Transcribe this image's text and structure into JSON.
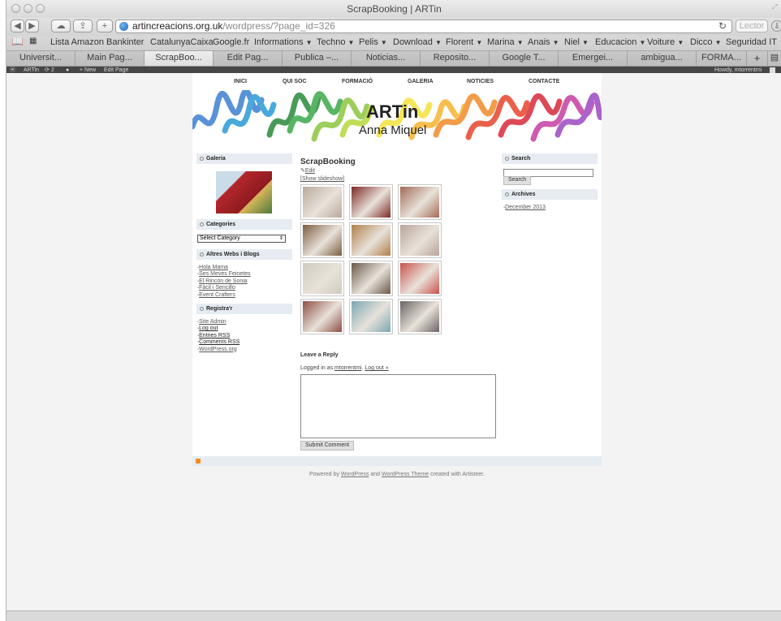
{
  "browser": {
    "window_title": "ScrapBooking | ARTin",
    "url_host": "artincreacions.org.uk",
    "url_path": "/wordpress/?page_id=326",
    "reader_label": "Lector"
  },
  "bookmarks": [
    {
      "label": "Lista Amazon",
      "menu": false
    },
    {
      "label": "Bankinter",
      "menu": false
    },
    {
      "label": "CatalunyaCaixa",
      "menu": false
    },
    {
      "label": "Google.fr",
      "menu": false
    },
    {
      "label": "Informations",
      "menu": true
    },
    {
      "label": "Techno",
      "menu": true
    },
    {
      "label": "Pelis",
      "menu": true
    },
    {
      "label": "Download",
      "menu": true
    },
    {
      "label": "Florent",
      "menu": true
    },
    {
      "label": "Marina",
      "menu": true
    },
    {
      "label": "Anais",
      "menu": true
    },
    {
      "label": "Niel",
      "menu": true
    },
    {
      "label": "Educacion",
      "menu": true
    },
    {
      "label": "Voiture",
      "menu": true
    },
    {
      "label": "Dicco",
      "menu": true
    },
    {
      "label": "Seguridad IT",
      "menu": true
    }
  ],
  "tabs": [
    "Universit...",
    "Main Pag...",
    "ScrapBoo...",
    "Edit Pag...",
    "Publica –...",
    "Noticias...",
    "Reposito...",
    "Google T...",
    "Emergei...",
    "ambigua...",
    "FORMA..."
  ],
  "active_tab": 2,
  "adminbar": {
    "site": "ARTin",
    "updates": "2",
    "new": "+ New",
    "edit": "Edit Page",
    "howdy": "Howdy, mtorrentmi"
  },
  "site": {
    "nav": [
      "INICI",
      "QUI SOC",
      "FORMACIÓ",
      "GALERIA",
      "NOTICIES",
      "CONTACTE"
    ],
    "brand": "ARTin",
    "tagline": "Anna Miquel"
  },
  "sidebar_left": {
    "galeria_title": "Galeria",
    "categories_title": "Categories",
    "category_select": "Select Category",
    "blogs_title": "Altres Webs i Blogs",
    "blogs": [
      "Hola Mama",
      "Ses Meves Feinetes",
      "El Rincón de Sonia",
      "Fàcil i Sencillo",
      "Event Crafters"
    ],
    "register_title": "Registra'r",
    "register_links": [
      "Site Admin",
      "Log out",
      "Entries RSS",
      "Comments RSS",
      "WordPress.org"
    ]
  },
  "main": {
    "title": "ScrapBooking",
    "edit_link": "Edit",
    "slideshow_link": "[Show slideshow]",
    "gallery_colors": [
      [
        "#b9a99a",
        "#7e2a25",
        "#a46a57"
      ],
      [
        "#7c5c40",
        "#b07f4a",
        "#b8a59a"
      ],
      [
        "#cfcac0",
        "#6a5848",
        "#c9524b"
      ],
      [
        "#8d4f44",
        "#7aa7b3",
        "#6a6363"
      ]
    ],
    "reply_title": "Leave a Reply",
    "logged_in_prefix": "Logged in as",
    "user": "mtorrentmi",
    "logout": "Log out »",
    "submit": "Submit Comment"
  },
  "sidebar_right": {
    "search_title": "Search",
    "search_button": "Search",
    "search_value": "",
    "archives_title": "Archives",
    "archives": [
      "December 2013"
    ]
  },
  "footer": {
    "powered": "Powered by",
    "wordpress": "WordPress",
    "and": "and",
    "theme": "WordPress Theme",
    "created": "created with Artisteer."
  },
  "colors": {
    "accent_link": "#555555",
    "box_header": "#e6ecf2",
    "admin_bar": "#464646",
    "rss": "#f28c1e"
  }
}
